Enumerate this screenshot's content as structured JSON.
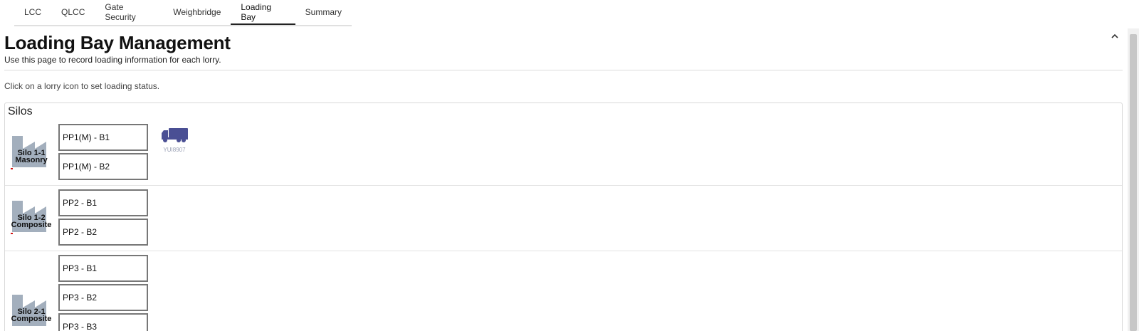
{
  "tabs": [
    {
      "label": "LCC",
      "active": false
    },
    {
      "label": "QLCC",
      "active": false
    },
    {
      "label": "Gate Security",
      "active": false
    },
    {
      "label": "Weighbridge",
      "active": false
    },
    {
      "label": "Loading Bay",
      "active": true
    },
    {
      "label": "Summary",
      "active": false
    }
  ],
  "header": {
    "title": "Loading Bay Management",
    "subtitle": "Use this page to record loading information for each lorry.",
    "collapse_icon": "chevron-up-icon"
  },
  "instruction": "Click on a lorry icon to set loading status.",
  "silos_section": {
    "title": "Silos",
    "rows": [
      {
        "silo_line1": "Silo 1-1",
        "silo_line2": "Masonry",
        "bays": [
          "PP1(M) - B1",
          "PP1(M) - B2"
        ],
        "lorries": [
          {
            "plate": "YUI8907",
            "bay": "PP1(M) - B1",
            "icon": "lorry-icon"
          }
        ]
      },
      {
        "silo_line1": "Silo 1-2",
        "silo_line2": "Composite",
        "bays": [
          "PP2 - B1",
          "PP2 - B2"
        ],
        "lorries": []
      },
      {
        "silo_line1": "Silo 2-1",
        "silo_line2": "Composite",
        "bays": [
          "PP3 - B1",
          "PP3 - B2",
          "PP3 - B3"
        ],
        "lorries": []
      }
    ]
  },
  "colors": {
    "silo_icon": "#a3afbd",
    "lorry_icon": "#4a4f94",
    "status_mark": "#d21414",
    "bay_border": "#777777"
  }
}
